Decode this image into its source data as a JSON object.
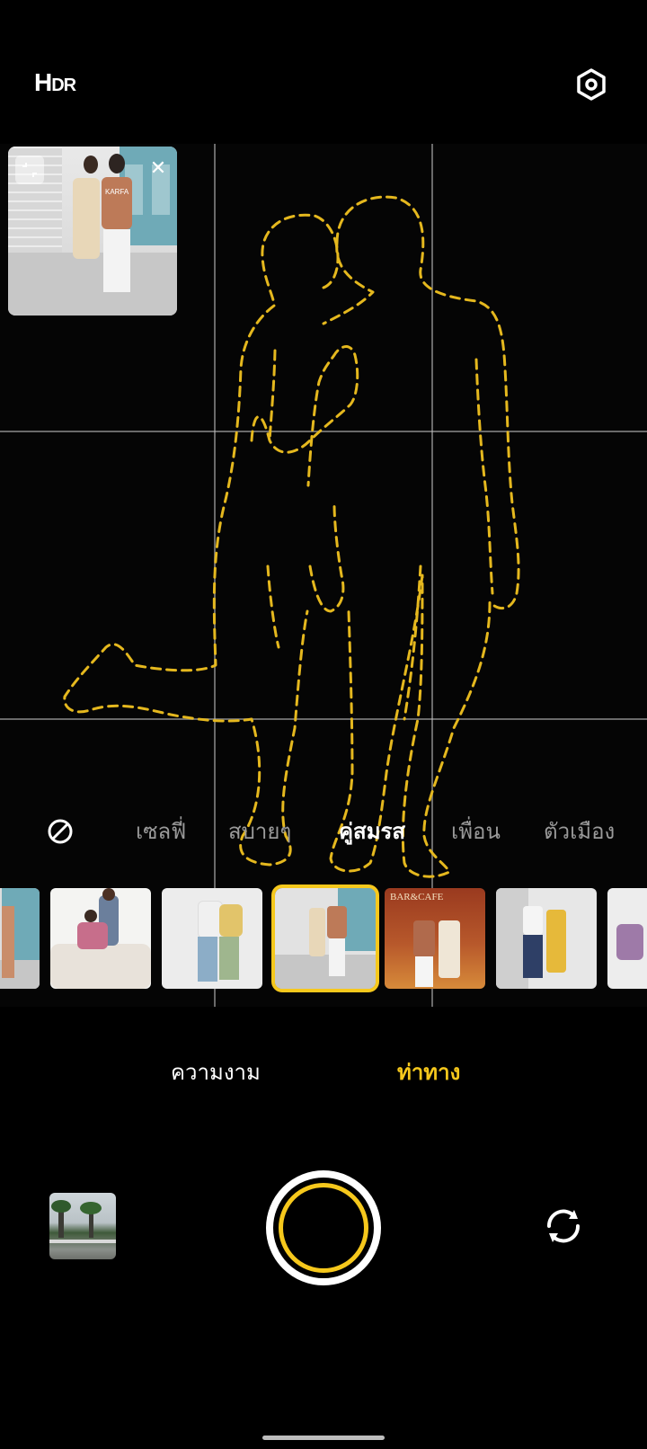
{
  "top_bar": {
    "hdr_label_big": "H",
    "hdr_label_small": "DR"
  },
  "pose_categories": [
    {
      "label": "เซลฟี่",
      "active": false
    },
    {
      "label": "สบายๆ",
      "active": false
    },
    {
      "label": "คู่สมรส",
      "active": true
    },
    {
      "label": "เพื่อน",
      "active": false
    },
    {
      "label": "ตัวเมือง",
      "active": false
    }
  ],
  "thumbnails": [
    {
      "name": "pose-thumb-1",
      "selected": false
    },
    {
      "name": "pose-thumb-2",
      "selected": false
    },
    {
      "name": "pose-thumb-3",
      "selected": false
    },
    {
      "name": "pose-thumb-4",
      "selected": true
    },
    {
      "name": "pose-thumb-5",
      "selected": false
    },
    {
      "name": "pose-thumb-6",
      "selected": false
    },
    {
      "name": "pose-thumb-7",
      "selected": false
    }
  ],
  "cafe_sign": "BAR&CAFE",
  "shirt_text": "KARFA",
  "modes": {
    "beauty": "ความงาม",
    "pose": "ท่าทาง"
  },
  "colors": {
    "accent": "#f6c81c",
    "background": "#000000",
    "outline": "#e5b81e"
  },
  "icons": {
    "settings": "settings-icon",
    "no_pose": "no-pose-icon",
    "flip": "flip-camera-icon",
    "close": "close-icon",
    "shrink": "shrink-icon"
  }
}
